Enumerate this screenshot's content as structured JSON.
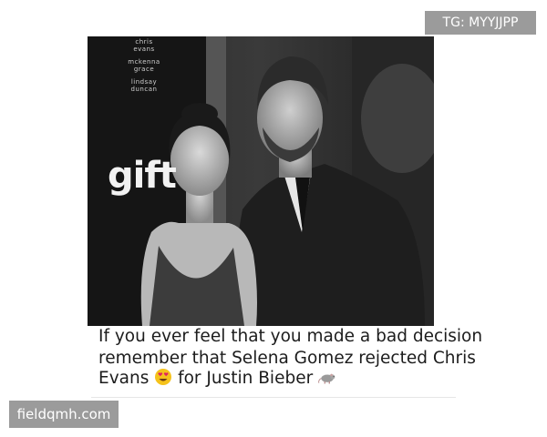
{
  "watermark_top": "TG: MYYJJPP",
  "watermark_bottom": "fieldqmh.com",
  "photo": {
    "poster_credits": [
      "chris",
      "evans",
      "mckenna",
      "grace",
      "lindsay",
      "duncan"
    ],
    "poster_logo": "gift"
  },
  "caption": {
    "line1": "If you ever feel that you made a bad decision",
    "line2": "remember that Selena Gomez rejected Chris",
    "line3_a": "Evans ",
    "line3_b": " for Justin Bieber ",
    "emoji1": "heart-eyes-emoji",
    "emoji2": "rat-emoji"
  }
}
